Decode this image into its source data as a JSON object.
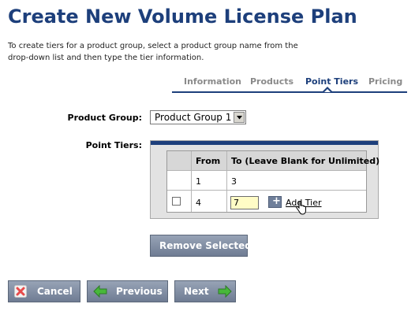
{
  "page": {
    "title": "Create New Volume License Plan",
    "instructions_line1": "To create tiers for a product group, select a product group name from the",
    "instructions_line2": "drop-down list and then type the tier information."
  },
  "tabs": [
    {
      "label": "Information",
      "active": false
    },
    {
      "label": "Products",
      "active": false
    },
    {
      "label": "Point Tiers",
      "active": true
    },
    {
      "label": "Pricing",
      "active": false
    }
  ],
  "form": {
    "product_group_label": "Product Group:",
    "product_group_value": "Product Group 1",
    "point_tiers_label": "Point Tiers:"
  },
  "tiers_table": {
    "headers": [
      "From",
      "To (Leave Blank for Unlimited)"
    ],
    "rows": [
      {
        "from": "1",
        "to": "3"
      },
      {
        "from": "4",
        "to": "7"
      }
    ],
    "add_tier_label": "Add Tier"
  },
  "buttons": {
    "remove_selected": "Remove Selected",
    "cancel": "Cancel",
    "previous": "Previous",
    "next": "Next"
  },
  "colors": {
    "title": "#1d3f7b",
    "accent_bar": "#1d3f7b",
    "button": "#7b879c",
    "input_highlight": "#fffcc6",
    "cancel_icon": "#e74b4b",
    "arrow_icon": "#48b83a"
  },
  "icons": {
    "cancel": "x-icon",
    "previous": "arrow-left-icon",
    "next": "arrow-right-icon",
    "add_tier": "plus-icon",
    "cursor": "hand-pointer-icon"
  }
}
